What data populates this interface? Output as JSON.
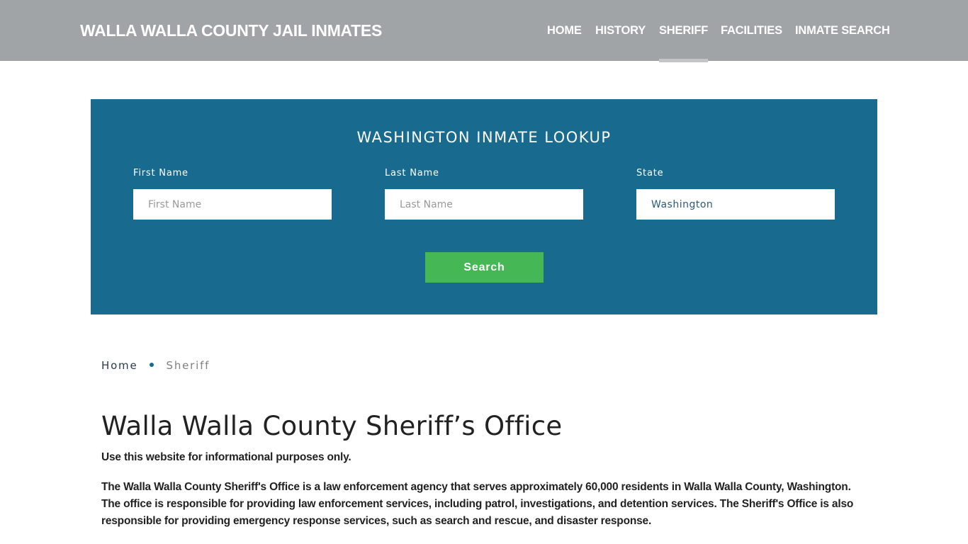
{
  "header": {
    "brand": "WALLA WALLA COUNTY JAIL INMATES",
    "nav": [
      {
        "label": "HOME",
        "active": false
      },
      {
        "label": "HISTORY",
        "active": false
      },
      {
        "label": "SHERIFF",
        "active": true
      },
      {
        "label": "FACILITIES",
        "active": false
      },
      {
        "label": "INMATE SEARCH",
        "active": false
      }
    ]
  },
  "lookup": {
    "title": "WASHINGTON INMATE LOOKUP",
    "first_name": {
      "label": "First Name",
      "placeholder": "First Name",
      "value": ""
    },
    "last_name": {
      "label": "Last Name",
      "placeholder": "Last Name",
      "value": ""
    },
    "state": {
      "label": "State",
      "value": "Washington"
    },
    "search_label": "Search"
  },
  "breadcrumb": {
    "home": "Home",
    "current": "Sheriff"
  },
  "main": {
    "title": "Walla Walla County Sheriff’s Office",
    "notice": "Use this website for informational purposes only.",
    "paragraph": "The Walla Walla County Sheriff's Office is a law enforcement agency that serves approximately 60,000 residents in Walla Walla County, Washington. The office is responsible for providing law enforcement services, including patrol, investigations, and detention services. The Sheriff's Office is also responsible for providing emergency response services, such as search and rescue, and disaster response."
  },
  "colors": {
    "header_bg": "#a0a4a7",
    "lookup_bg": "#186b8e",
    "search_button": "#45b755",
    "active_underline": "#c3c5c6"
  }
}
